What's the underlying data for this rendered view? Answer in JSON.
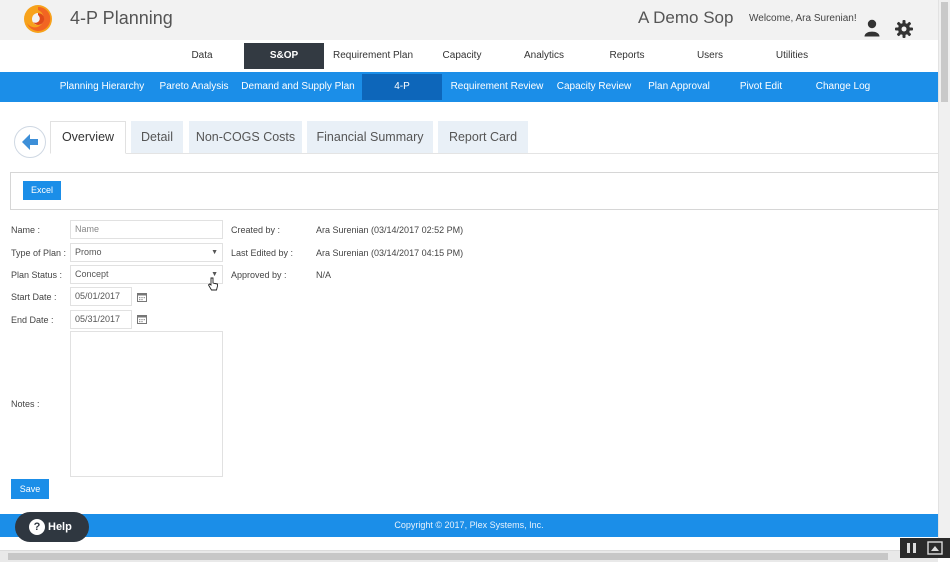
{
  "header": {
    "app_title": "4-P Planning",
    "company": "A Demo Sop",
    "welcome": "Welcome, Ara Surenian!",
    "brand_color": "#f26522"
  },
  "main_nav": {
    "items": [
      {
        "label": "Data"
      },
      {
        "label": "S&OP",
        "active": true
      },
      {
        "label": "Requirement Plan"
      },
      {
        "label": "Capacity"
      },
      {
        "label": "Analytics"
      },
      {
        "label": "Reports"
      },
      {
        "label": "Users"
      },
      {
        "label": "Utilities"
      }
    ]
  },
  "sub_nav": {
    "items": [
      {
        "label": "Planning Hierarchy"
      },
      {
        "label": "Pareto Analysis"
      },
      {
        "label": "Demand and Supply Plan"
      },
      {
        "label": "4-P",
        "active": true
      },
      {
        "label": "Requirement Review"
      },
      {
        "label": "Capacity Review"
      },
      {
        "label": "Plan Approval"
      },
      {
        "label": "Pivot Edit"
      },
      {
        "label": "Change Log"
      }
    ]
  },
  "tabs": [
    {
      "label": "Overview",
      "active": true
    },
    {
      "label": "Detail"
    },
    {
      "label": "Non-COGS Costs"
    },
    {
      "label": "Financial Summary"
    },
    {
      "label": "Report Card"
    }
  ],
  "toolbar": {
    "excel_label": "Excel"
  },
  "form": {
    "name_label": "Name :",
    "name_placeholder": "Name",
    "type_label": "Type of Plan :",
    "type_value": "Promo",
    "status_label": "Plan Status :",
    "status_value": "Concept",
    "start_label": "Start Date :",
    "start_value": "05/01/2017",
    "end_label": "End Date :",
    "end_value": "05/31/2017",
    "notes_label": "Notes :",
    "save_label": "Save"
  },
  "info": {
    "created_label": "Created by :",
    "created_value": "Ara Surenian (03/14/2017 02:52 PM)",
    "edited_label": "Last Edited by :",
    "edited_value": "Ara Surenian (03/14/2017 04:15 PM)",
    "approved_label": "Approved by :",
    "approved_value": "N/A"
  },
  "footer": {
    "copyright": "Copyright © 2017, Plex Systems, Inc.",
    "help_label": "Help"
  },
  "colors": {
    "primary": "#1b8ee8",
    "nav_active": "#333a42",
    "sub_nav_active": "#0d66ba"
  }
}
